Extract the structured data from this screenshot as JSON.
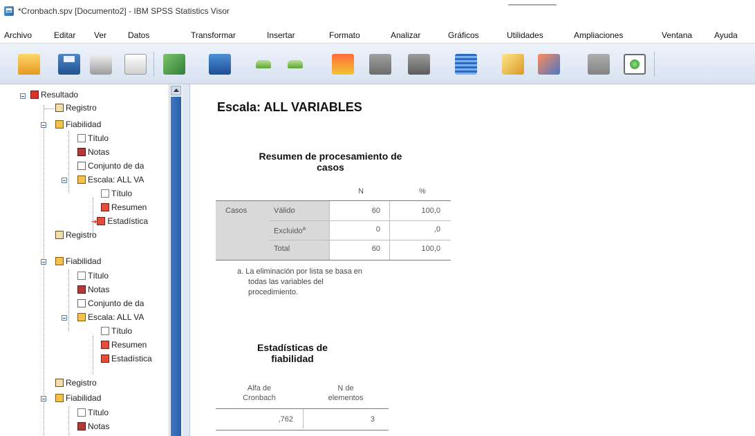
{
  "window": {
    "title": "*Cronbach.spv [Documento2] - IBM SPSS Statistics Visor"
  },
  "menu": [
    {
      "label": "Archivo"
    },
    {
      "label": "Editar"
    },
    {
      "label": "Ver"
    },
    {
      "label": "Datos"
    },
    {
      "label": "Transformar"
    },
    {
      "label": "Insertar"
    },
    {
      "label": "Formato"
    },
    {
      "label": "Analizar"
    },
    {
      "label": "Gráficos"
    },
    {
      "label": "Utilidades"
    },
    {
      "label": "Ampliaciones"
    },
    {
      "label": "Ventana"
    },
    {
      "label": "Ayuda"
    }
  ],
  "toolbar": [
    {
      "icon": "open-folder-icon"
    },
    {
      "icon": "save-icon"
    },
    {
      "icon": "print-icon"
    },
    {
      "icon": "print-preview-icon"
    },
    {
      "icon": "export-icon"
    },
    {
      "icon": "recall-dialog-icon"
    },
    {
      "icon": "undo-icon"
    },
    {
      "icon": "redo-icon"
    },
    {
      "icon": "goto-data-icon"
    },
    {
      "icon": "goto-case-icon"
    },
    {
      "icon": "goto-variable-icon"
    },
    {
      "icon": "variables-icon"
    },
    {
      "icon": "create-script-icon"
    },
    {
      "icon": "run-script-icon"
    },
    {
      "icon": "designate-window-icon"
    },
    {
      "icon": "add-icon"
    }
  ],
  "nav": {
    "items": [
      {
        "label": "Resultado",
        "icon": "folder-red-icon"
      },
      {
        "label": "Registro",
        "icon": "log-icon"
      },
      {
        "label": "Fiabilidad",
        "icon": "folder-icon"
      },
      {
        "label": "Título",
        "icon": "title-icon"
      },
      {
        "label": "Notas",
        "icon": "notes-icon"
      },
      {
        "label": "Conjunto de da",
        "icon": "dataset-icon"
      },
      {
        "label": "Escala: ALL VA",
        "icon": "folder-icon"
      },
      {
        "label": "Título",
        "icon": "title-icon"
      },
      {
        "label": "Resumen",
        "icon": "table-icon"
      },
      {
        "label": "Estadística",
        "icon": "table-icon"
      },
      {
        "label": "Registro",
        "icon": "log-icon"
      },
      {
        "label": "Fiabilidad",
        "icon": "folder-icon"
      },
      {
        "label": "Título",
        "icon": "title-icon"
      },
      {
        "label": "Notas",
        "icon": "notes-icon"
      },
      {
        "label": "Conjunto de da",
        "icon": "dataset-icon"
      },
      {
        "label": "Escala: ALL VA",
        "icon": "folder-icon"
      },
      {
        "label": "Título",
        "icon": "title-icon"
      },
      {
        "label": "Resumen",
        "icon": "table-icon"
      },
      {
        "label": "Estadística",
        "icon": "table-icon"
      },
      {
        "label": "Registro",
        "icon": "log-icon"
      },
      {
        "label": "Fiabilidad",
        "icon": "folder-icon"
      },
      {
        "label": "Título",
        "icon": "title-icon"
      },
      {
        "label": "Notas",
        "icon": "notes-icon"
      }
    ]
  },
  "output": {
    "heading": "Escala: ALL VARIABLES",
    "case_summary": {
      "title_line1": "Resumen de procesamiento de",
      "title_line2": "casos",
      "col_n": "N",
      "col_pct": "%",
      "group_label": "Casos",
      "rows": [
        {
          "label": "Válido",
          "n": "60",
          "pct": "100,0"
        },
        {
          "label": "Excluido",
          "sup": "a",
          "n": "0",
          "pct": ",0"
        },
        {
          "label": "Total",
          "n": "60",
          "pct": "100,0"
        }
      ],
      "footnote_line1": "a. La eliminación por lista se basa en",
      "footnote_line2": "todas las variables del",
      "footnote_line3": "procedimiento."
    },
    "reliability": {
      "title_line1": "Estadísticas de",
      "title_line2": "fiabilidad",
      "col1_line1": "Alfa de",
      "col1_line2": "Cronbach",
      "col2_line1": "N de",
      "col2_line2": "elementos",
      "alpha": ",762",
      "n_items": "3"
    }
  }
}
